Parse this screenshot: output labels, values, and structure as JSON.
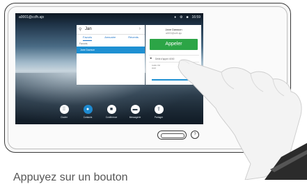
{
  "status": {
    "address": "a0001@ccfh.ajo",
    "time": "16:59"
  },
  "search": {
    "value": "Jan"
  },
  "tabs": [
    {
      "label": "Favoris"
    },
    {
      "label": "Annuaire"
    },
    {
      "label": "Récents"
    }
  ],
  "section_label": "Favoris",
  "contact": {
    "name": "Jane Dawson"
  },
  "card": {
    "name": "Jane Dawson",
    "address": "a0003@ccfh.ajo",
    "call_label": "Appeler",
    "row_text": "Débit d'appel: 6000",
    "meta_line1": "Audio    Vid",
    "meta_line2": "Hold"
  },
  "dock": [
    {
      "label": "Clavier",
      "icon": "keypad-icon"
    },
    {
      "label": "Contacts",
      "icon": "contacts-icon"
    },
    {
      "label": "Conférence",
      "icon": "conference-icon"
    },
    {
      "label": "Messagerie",
      "icon": "message-icon"
    },
    {
      "label": "Partager",
      "icon": "share-icon"
    }
  ],
  "caption": "Appuyez sur un bouton"
}
